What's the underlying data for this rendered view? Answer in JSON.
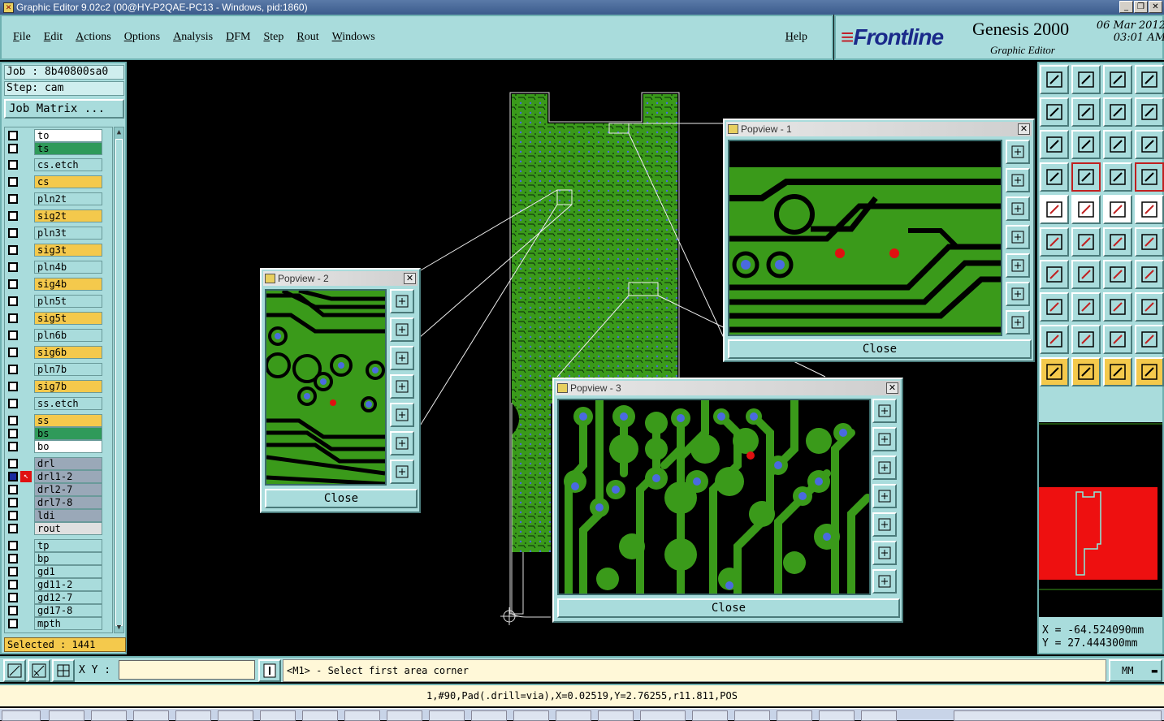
{
  "window": {
    "title": "Graphic Editor 9.02c2 (00@HY-P2QAE-PC13 - Windows, pid:1860)"
  },
  "menu": {
    "items": [
      "File",
      "Edit",
      "Actions",
      "Options",
      "Analysis",
      "DFM",
      "Step",
      "Rout",
      "Windows"
    ],
    "help": "Help"
  },
  "brand": {
    "logo": "Frontline",
    "product": "Genesis 2000",
    "subtitle": "Graphic Editor",
    "date": "06 Mar 2012",
    "time": "03:01 AM"
  },
  "job": {
    "job_label": "Job : 8b40800sa0",
    "step_label": "Step: cam",
    "matrix_button": "Job Matrix ..."
  },
  "layers": [
    {
      "name": "to",
      "color": "#ffffff"
    },
    {
      "name": "ts",
      "color": "#2f9a5a"
    },
    {
      "name": "cs.etch",
      "color": "#a9dcdc"
    },
    {
      "name": "cs",
      "color": "#f4c94c"
    },
    {
      "name": "pln2t",
      "color": "#a9dcdc"
    },
    {
      "name": "sig2t",
      "color": "#f4c94c"
    },
    {
      "name": "pln3t",
      "color": "#a9dcdc"
    },
    {
      "name": "sig3t",
      "color": "#f4c94c"
    },
    {
      "name": "pln4b",
      "color": "#a9dcdc"
    },
    {
      "name": "sig4b",
      "color": "#f4c94c"
    },
    {
      "name": "pln5t",
      "color": "#a9dcdc"
    },
    {
      "name": "sig5t",
      "color": "#f4c94c"
    },
    {
      "name": "pln6b",
      "color": "#a9dcdc"
    },
    {
      "name": "sig6b",
      "color": "#f4c94c"
    },
    {
      "name": "pln7b",
      "color": "#a9dcdc"
    },
    {
      "name": "sig7b",
      "color": "#f4c94c"
    },
    {
      "name": "ss.etch",
      "color": "#a9dcdc"
    },
    {
      "name": "ss",
      "color": "#f4c94c"
    },
    {
      "name": "bs",
      "color": "#2f9a5a"
    },
    {
      "name": "bo",
      "color": "#ffffff"
    },
    {
      "name": "drl",
      "color": "#9aa8b8"
    },
    {
      "name": "drl1-2",
      "color": "#9aa8b8"
    },
    {
      "name": "drl2-7",
      "color": "#9aa8b8"
    },
    {
      "name": "drl7-8",
      "color": "#9aa8b8"
    },
    {
      "name": "ldi",
      "color": "#9aa8b8"
    },
    {
      "name": "rout",
      "color": "#e0e0e0"
    },
    {
      "name": "tp",
      "color": "#a9dcdc"
    },
    {
      "name": "bp",
      "color": "#a9dcdc"
    },
    {
      "name": "gd1",
      "color": "#a9dcdc"
    },
    {
      "name": "gd11-2",
      "color": "#a9dcdc"
    },
    {
      "name": "gd12-7",
      "color": "#a9dcdc"
    },
    {
      "name": "gd17-8",
      "color": "#a9dcdc"
    },
    {
      "name": "mpth",
      "color": "#a9dcdc"
    }
  ],
  "selected_label": "Selected : 1441",
  "popviews": [
    {
      "title": "Popview - 1",
      "close": "Close"
    },
    {
      "title": "Popview - 2",
      "close": "Close"
    },
    {
      "title": "Popview - 3",
      "close": "Close"
    }
  ],
  "coords": {
    "x": "X  = -64.524090mm",
    "y": "Y  = 27.444300mm"
  },
  "bottom": {
    "xy_label": "X Y :",
    "xy_value": "",
    "prompt": "<M1> - Select first area corner",
    "units": "MM"
  },
  "status": "1,#90,Pad(.drill=via),X=0.02519,Y=2.76255,r11.811,POS",
  "colors": {
    "panel": "#a9dcdc",
    "copper": "#3a9a1a",
    "via": "#4a6ae0",
    "highlight": "#e01010"
  }
}
